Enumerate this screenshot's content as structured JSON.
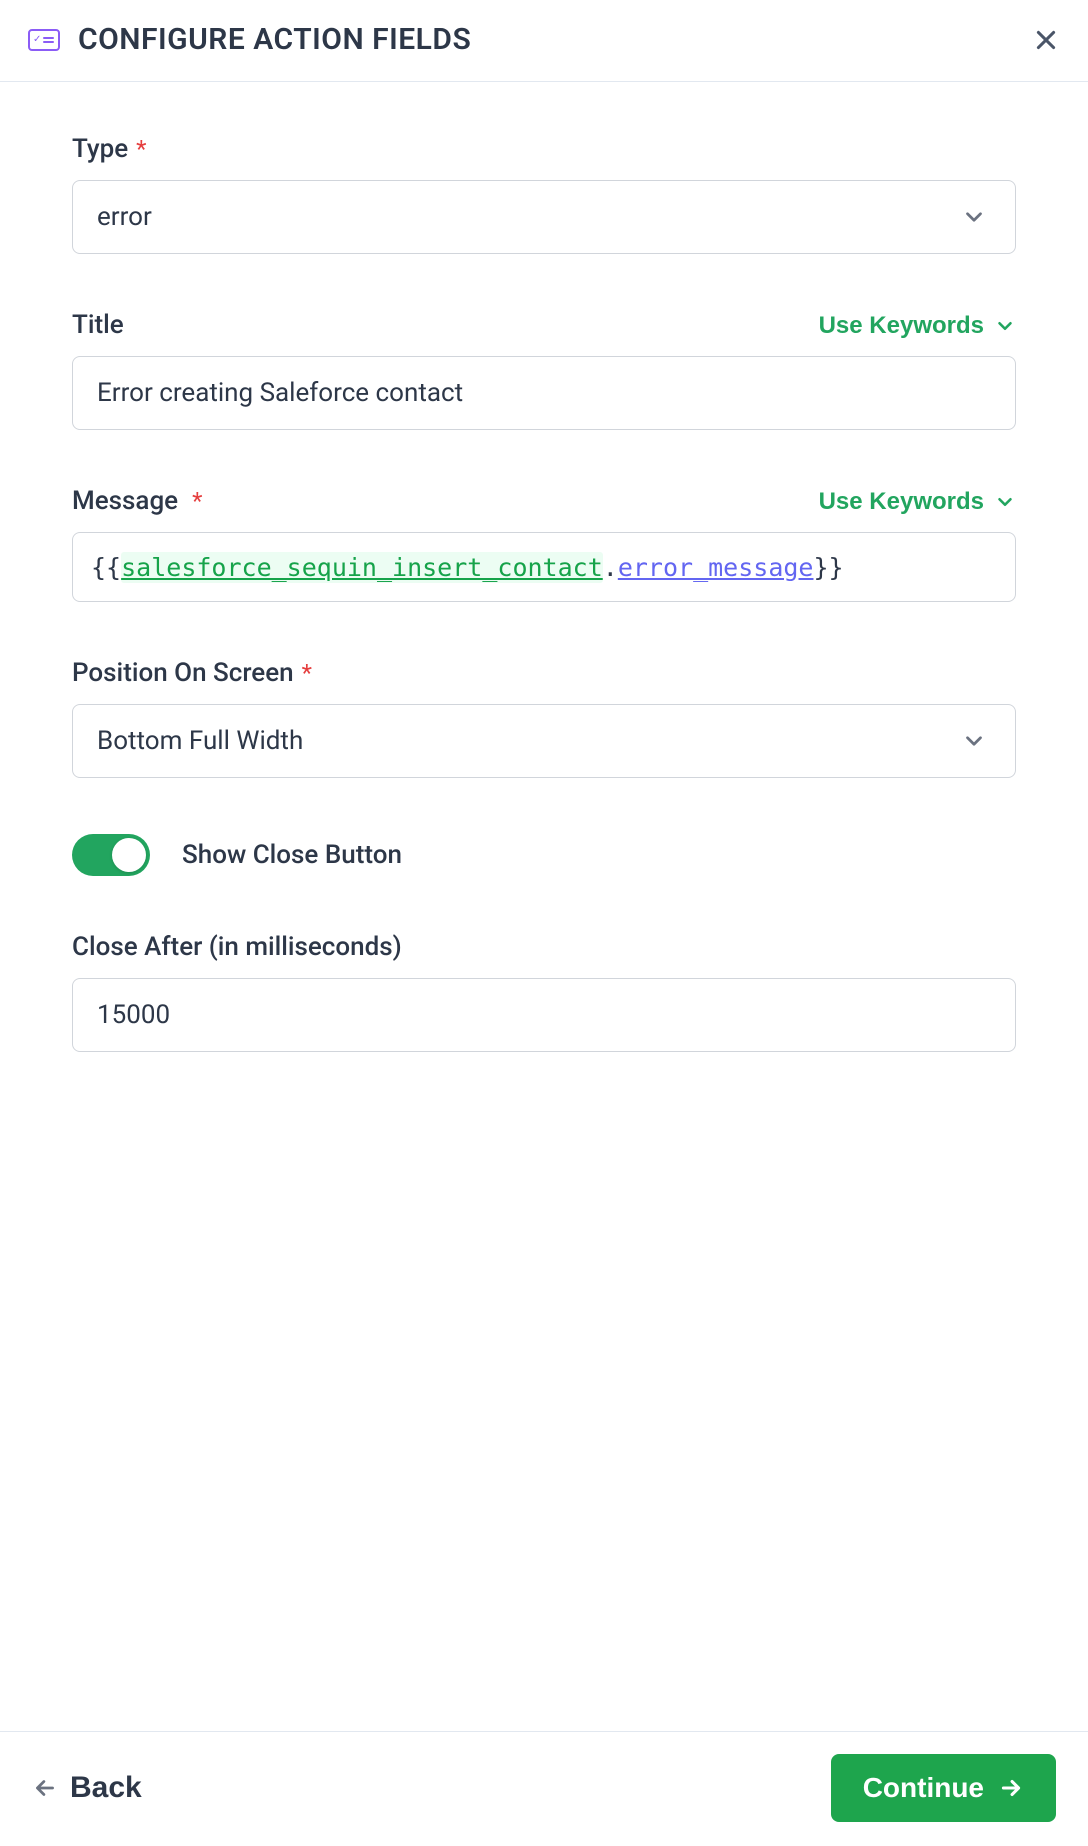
{
  "header": {
    "title": "CONFIGURE ACTION FIELDS"
  },
  "fields": {
    "type": {
      "label": "Type",
      "required": true,
      "value": "error"
    },
    "title": {
      "label": "Title",
      "required": false,
      "use_keywords_label": "Use Keywords",
      "value": "Error creating Saleforce contact"
    },
    "message": {
      "label": "Message",
      "required": true,
      "use_keywords_label": "Use Keywords",
      "value_open": "{{",
      "value_token_a": "salesforce_sequin_insert_contact",
      "value_dot": ".",
      "value_token_b": "error_message",
      "value_close": "}}"
    },
    "position": {
      "label": "Position On Screen",
      "required": true,
      "value": "Bottom Full Width"
    },
    "show_close": {
      "label": "Show Close Button",
      "value": true
    },
    "close_after": {
      "label": "Close After (in milliseconds)",
      "value": "15000"
    }
  },
  "footer": {
    "back_label": "Back",
    "continue_label": "Continue"
  },
  "colors": {
    "accent_green": "#22a55f",
    "accent_purple": "#8b5cf6",
    "text": "#2d3748",
    "border": "#d1d5db"
  }
}
